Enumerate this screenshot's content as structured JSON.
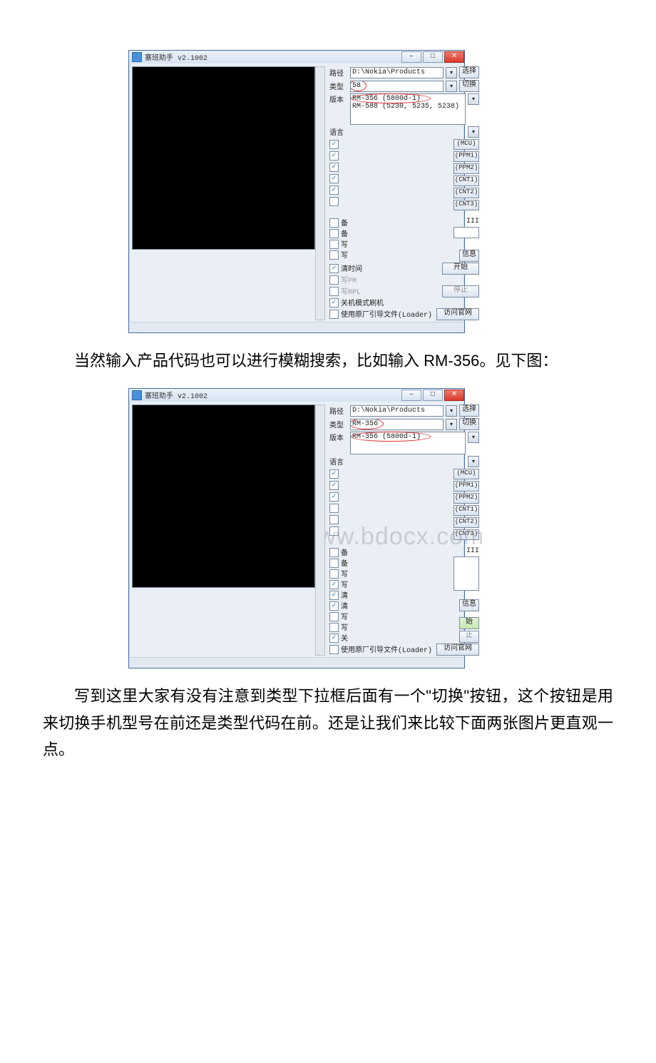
{
  "shot1": {
    "title": "塞班助手 v2.1002",
    "path_lbl": "路径",
    "path_val": "D:\\Nokia\\Products",
    "select_btn": "选择",
    "type_lbl": "类型",
    "type_val": "58",
    "switch_btn": "切换",
    "ver_lbl": "版本",
    "lang_lbl": "语言",
    "list_line1": "RM-356    (5800d-1)",
    "list_line2": "RM-588    (5230, 5235, 5238)",
    "filebtns": [
      "(MCU)",
      "(PPM1)",
      "(PPM2)",
      "(CNT1)",
      "(CNT2)",
      "(CNT3)"
    ],
    "iii": "III",
    "info_btn": "信息",
    "clear_time": "清时间",
    "write": "写PM",
    "writeRPL": "写RPL",
    "shutdown_flash": "关机模式刷机",
    "use_loader": "使用原厂引导文件(Loader)",
    "start_btn": "开始",
    "stop_btn": "停止",
    "visit_btn": "访问官网"
  },
  "para1": "当然输入产品代码也可以进行模糊搜索，比如输入 RM-356。见下图：",
  "shot2": {
    "title": "塞班助手 v2.1002",
    "path_lbl": "路径",
    "path_val": "D:\\Nokia\\Products",
    "select_btn": "选择",
    "type_lbl": "类型",
    "type_val": "RM-356",
    "switch_btn": "切换",
    "ver_lbl": "版本",
    "lang_lbl": "语言",
    "list_line1": "RM-356    (5800d-1)",
    "filebtns": [
      "(MCU)",
      "(PPM1)",
      "(PPM2)",
      "(CNT1)",
      "(CNT2)",
      "(CNT3)"
    ],
    "iii": "III",
    "info_btn": "信息",
    "use_loader": "使用原厂引导文件(Loader)",
    "start_btn": "始",
    "stop_btn": "止",
    "visit_btn": "访问官网"
  },
  "watermark": "www.bdocx.com",
  "para2": "写到这里大家有没有注意到类型下拉框后面有一个\"切换\"按钮，这个按钮是用来切换手机型号在前还是类型代码在前。还是让我们来比较下面两张图片更直观一点。"
}
